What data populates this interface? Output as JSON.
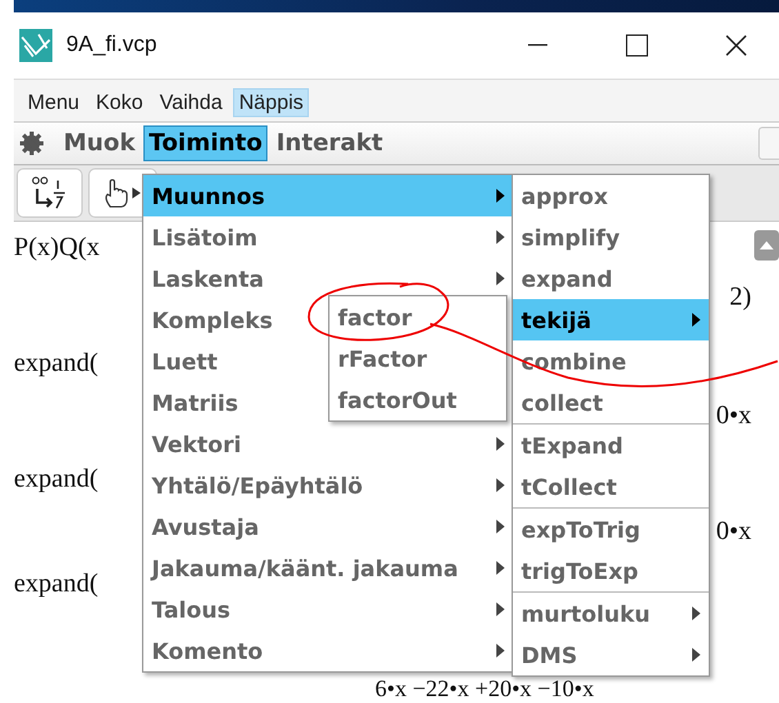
{
  "window": {
    "title": "9A_fi.vcp"
  },
  "menubar": [
    {
      "label": "Menu",
      "selected": false
    },
    {
      "label": "Koko",
      "selected": false
    },
    {
      "label": "Vaihda",
      "selected": false
    },
    {
      "label": "Näppis",
      "selected": true
    }
  ],
  "toolbar": [
    {
      "label": "Muok",
      "selected": false
    },
    {
      "label": "Toiminto",
      "selected": true
    },
    {
      "label": "Interakt",
      "selected": false
    }
  ],
  "worksheet": {
    "lines": [
      {
        "left": "P(x)Q(x",
        "right": "2)"
      },
      {
        "left": "expand(",
        "right": "0•x"
      },
      {
        "left": "expand(",
        "right": "0•x"
      },
      {
        "left": "expand("
      }
    ],
    "last_line": "6•x −22•x +20•x  −10•x"
  },
  "menu": [
    {
      "label": "Muunnos",
      "selected": true
    },
    {
      "label": "Lisätoim",
      "selected": false
    },
    {
      "label": "Laskenta",
      "selected": false
    },
    {
      "label": "Kompleks",
      "selected": false
    },
    {
      "label": "Luett",
      "selected": false
    },
    {
      "label": "Matriis",
      "selected": false
    },
    {
      "label": "Vektori",
      "selected": false
    },
    {
      "label": "Yhtälö/Epäyhtälö",
      "selected": false
    },
    {
      "label": "Avustaja",
      "selected": false
    },
    {
      "label": "Jakauma/käänt. jakauma",
      "selected": false
    },
    {
      "label": "Talous",
      "selected": false
    },
    {
      "label": "Komento",
      "selected": false
    }
  ],
  "submenu": [
    [
      {
        "label": "approx",
        "selected": false,
        "has_submenu": false
      },
      {
        "label": "simplify",
        "selected": false,
        "has_submenu": false
      },
      {
        "label": "expand",
        "selected": false,
        "has_submenu": false
      },
      {
        "label": "tekijä",
        "selected": true,
        "has_submenu": true
      },
      {
        "label": "combine",
        "selected": false,
        "has_submenu": false
      },
      {
        "label": "collect",
        "selected": false,
        "has_submenu": false
      }
    ],
    [
      {
        "label": "tExpand",
        "selected": false,
        "has_submenu": false
      },
      {
        "label": "tCollect",
        "selected": false,
        "has_submenu": false
      }
    ],
    [
      {
        "label": "expToTrig",
        "selected": false,
        "has_submenu": false
      },
      {
        "label": "trigToExp",
        "selected": false,
        "has_submenu": false
      }
    ],
    [
      {
        "label": "murtoluku",
        "selected": false,
        "has_submenu": true
      },
      {
        "label": "DMS",
        "selected": false,
        "has_submenu": true
      }
    ]
  ],
  "factor_menu": [
    {
      "label": "factor",
      "selected": false
    },
    {
      "label": "rFactor",
      "selected": false
    },
    {
      "label": "factorOut",
      "selected": false
    }
  ]
}
